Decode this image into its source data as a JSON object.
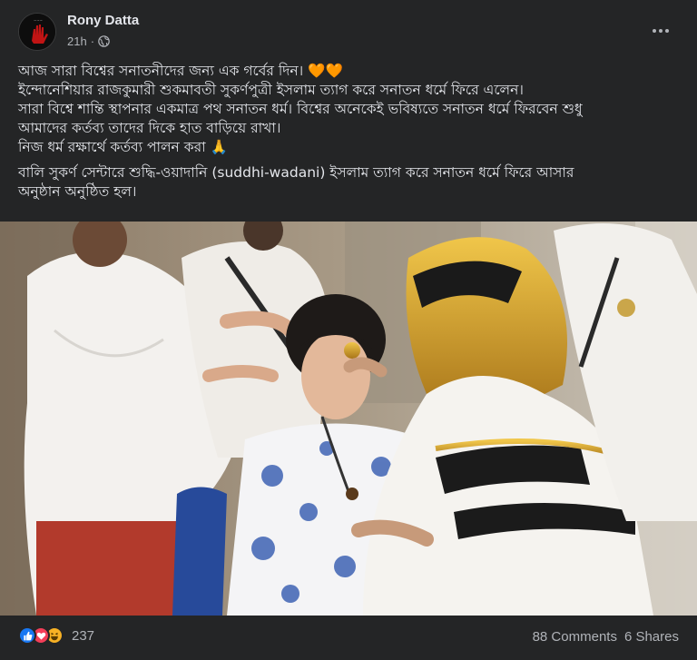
{
  "post": {
    "author": "Rony Datta",
    "time": "21h",
    "time_separator": "·",
    "privacy_icon": "globe-icon",
    "more_icon": "more-options-icon",
    "lines": [
      "আজ সারা বিশ্বের সনাতনীদের জন্য এক গর্বের দিন। 🧡🧡",
      "ইন্দোনেশিয়ার রাজকুমারী শুকমাবতী সুকর্ণপুত্রী ইসলাম ত্যাগ করে সনাতন ধর্মে ফিরে এলেন।",
      "সারা বিশ্বে শান্তি স্থাপনার একমাত্র পথ সনাতন ধর্ম। বিশ্বের অনেকেই ভবিষ্যতে সনাতন ধর্মে ফিরবেন শুধু",
      "আমাদের কর্তব্য তাদের দিকে হাত বাড়িয়ে রাখা।",
      "নিজ ধর্ম রক্ষার্থে কর্তব্য পালন করা 🙏"
    ],
    "lines2": [
      "বালি সুকর্ণ সেন্টারে শুদ্ধি-ওয়াদানি (suddhi-wadani) ইসলাম ত্যাগ করে সনাতন ধর্মে ফিরে আসার",
      "অনুষ্ঠান অনুষ্ঠিত হল।"
    ]
  },
  "footer": {
    "reactions": [
      "like-reaction-icon",
      "love-reaction-icon",
      "haha-reaction-icon"
    ],
    "reaction_count": "237",
    "comments": "88 Comments",
    "shares": "6 Shares"
  },
  "colors": {
    "background": "#242526",
    "text": "#e4e6eb",
    "secondary_text": "#b0b3b8",
    "like_blue": "#1877f2",
    "love_red": "#f33e58",
    "haha_yellow": "#f7b125"
  }
}
